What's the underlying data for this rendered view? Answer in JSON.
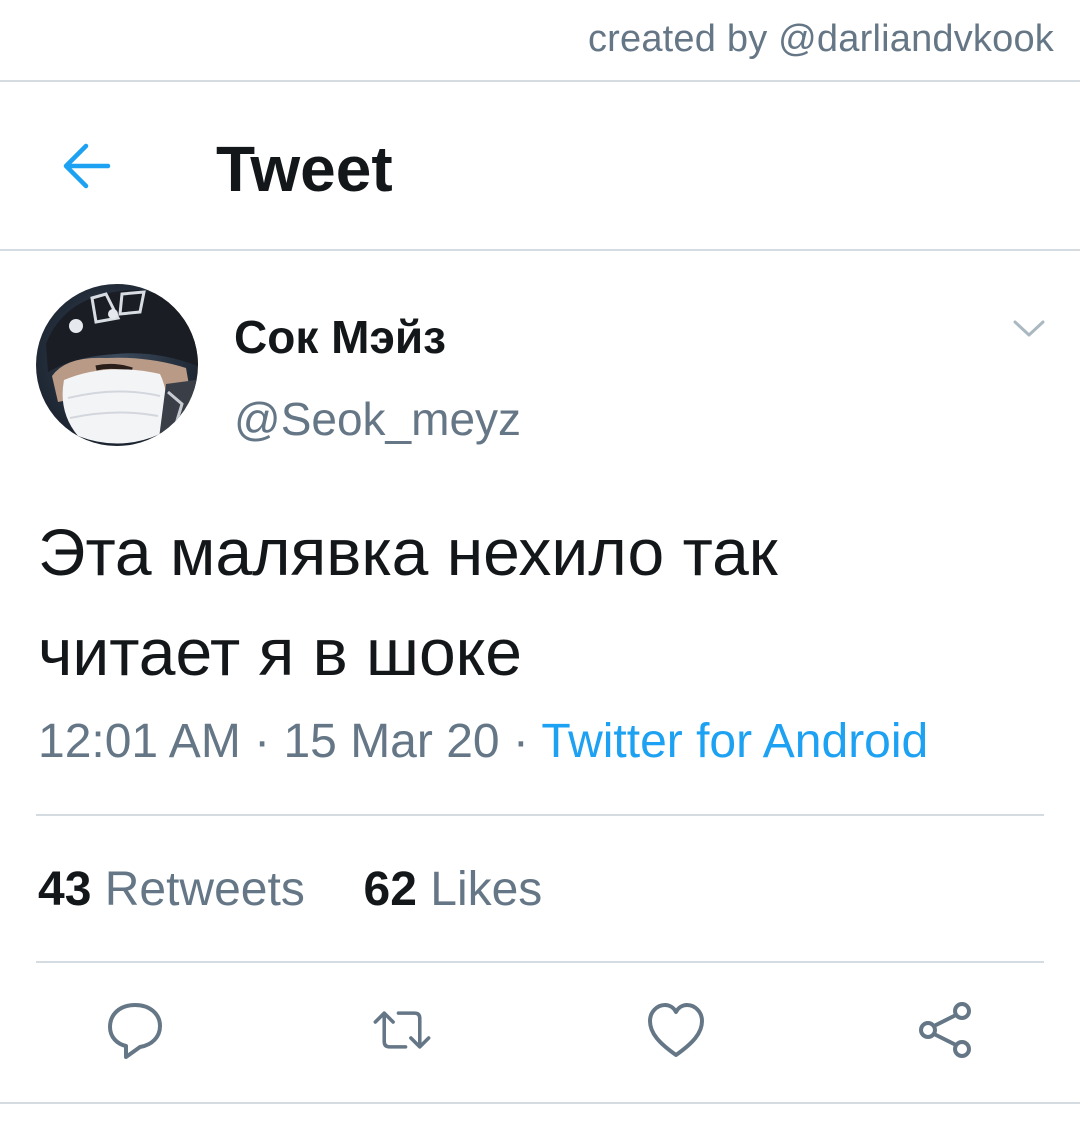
{
  "credit": "created by @darliandvkook",
  "header": {
    "title": "Tweet",
    "back_icon": "arrow-left-icon"
  },
  "colors": {
    "accent": "#1da1f2",
    "text_primary": "#14171a",
    "text_secondary": "#657786",
    "divider": "#d4dbe1"
  },
  "tweet": {
    "author": {
      "display_name": "Сок Мэйз",
      "handle": "@Seok_meyz"
    },
    "text_lines": [
      "Эта малявка нехило так",
      "читает я в шоке"
    ],
    "time": "12:01 AM",
    "sep": " · ",
    "date": "15 Mar 20",
    "source": "Twitter for Android",
    "retweets_count": "43",
    "retweets_label": "Retweets",
    "likes_count": "62",
    "likes_label": "Likes"
  },
  "actions": [
    {
      "name": "reply",
      "icon": "reply-bubble-icon"
    },
    {
      "name": "retweet",
      "icon": "retweet-icon"
    },
    {
      "name": "like",
      "icon": "heart-icon"
    },
    {
      "name": "share",
      "icon": "share-icon"
    }
  ]
}
